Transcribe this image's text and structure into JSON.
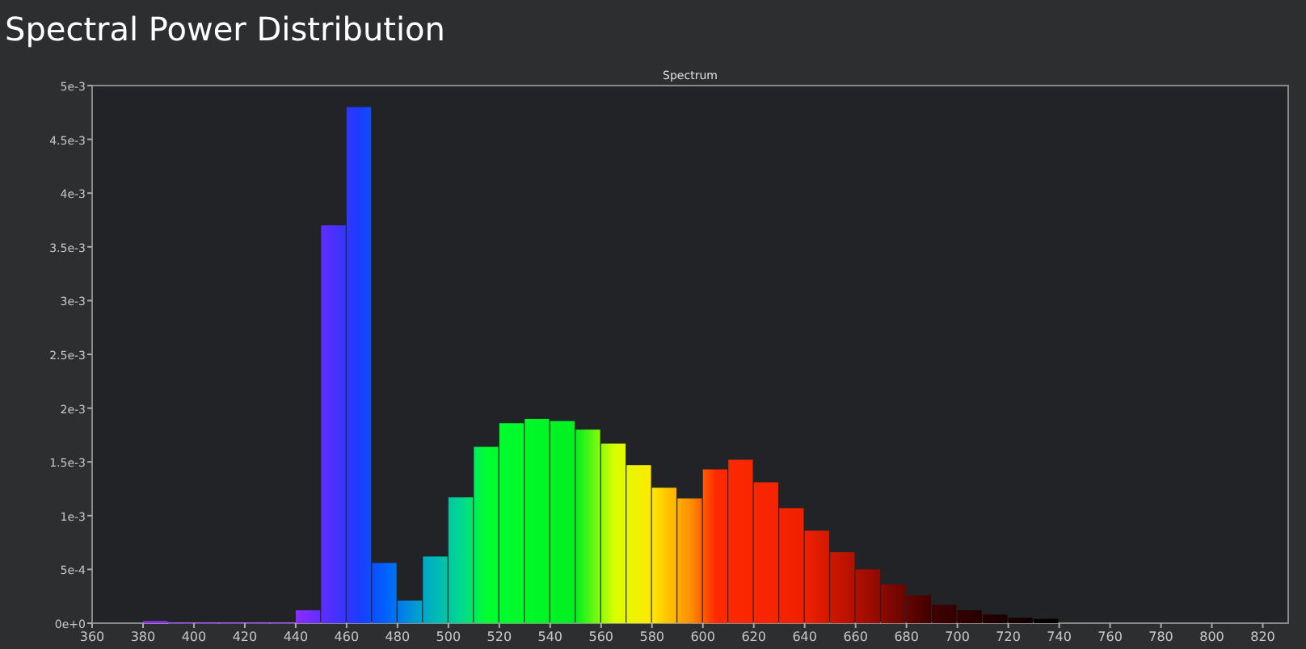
{
  "page_title": "Spectral Power Distribution",
  "chart": {
    "chart_data": {
      "type": "bar",
      "title": "Spectrum",
      "x": [
        385,
        395,
        405,
        415,
        425,
        435,
        445,
        455,
        465,
        475,
        485,
        495,
        505,
        515,
        525,
        535,
        545,
        555,
        565,
        575,
        585,
        595,
        605,
        615,
        625,
        635,
        645,
        655,
        665,
        675,
        685,
        695,
        705,
        715,
        725,
        735
      ],
      "values": [
        2e-05,
        0,
        0,
        0,
        0,
        0,
        0.00012,
        0.0037,
        0.0048,
        0.00056,
        0.00021,
        0.00062,
        0.00117,
        0.00164,
        0.00186,
        0.0019,
        0.00188,
        0.0018,
        0.00167,
        0.00147,
        0.00126,
        0.00116,
        0.00143,
        0.00152,
        0.00131,
        0.00107,
        0.00086,
        0.00066,
        0.0005,
        0.00036,
        0.00026,
        0.00017,
        0.00012,
        8e-05,
        5e-05,
        4e-05
      ],
      "xlim": [
        360,
        830
      ],
      "ylim": [
        0,
        0.005
      ],
      "xticks": [
        360,
        380,
        400,
        420,
        440,
        460,
        480,
        500,
        520,
        540,
        560,
        580,
        600,
        620,
        640,
        660,
        680,
        700,
        720,
        740,
        760,
        780,
        800,
        820
      ],
      "yticks": [
        {
          "value": 0,
          "label": "0e+0"
        },
        {
          "value": 0.0005,
          "label": "5e-4"
        },
        {
          "value": 0.001,
          "label": "1e-3"
        },
        {
          "value": 0.0015,
          "label": "1.5e-3"
        },
        {
          "value": 0.002,
          "label": "2e-3"
        },
        {
          "value": 0.0025,
          "label": "2.5e-3"
        },
        {
          "value": 0.003,
          "label": "3e-3"
        },
        {
          "value": 0.0035,
          "label": "3.5e-3"
        },
        {
          "value": 0.004,
          "label": "4e-3"
        },
        {
          "value": 0.0045,
          "label": "4.5e-3"
        },
        {
          "value": 0.005,
          "label": "5e-3"
        }
      ]
    }
  }
}
